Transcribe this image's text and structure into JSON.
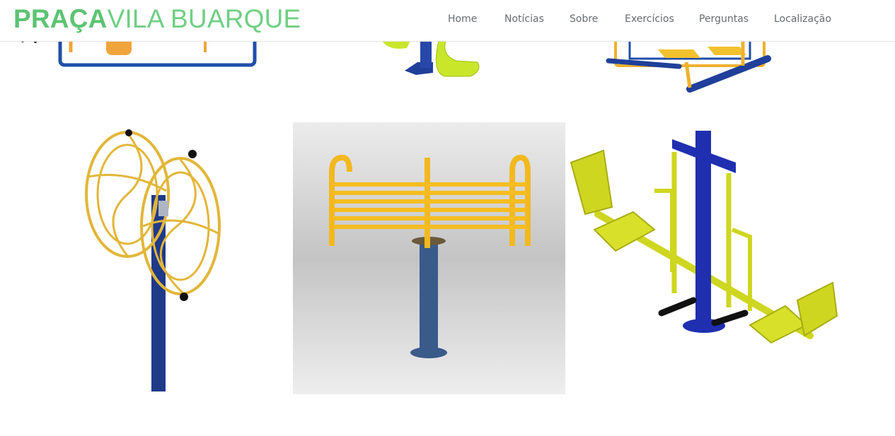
{
  "site": {
    "logo_bold": "PRAÇA",
    "logo_light": "VILA BUARQUE",
    "accent_color": "#5cc472"
  },
  "nav": {
    "items": [
      {
        "label": "Home"
      },
      {
        "label": "Notícias"
      },
      {
        "label": "Sobre"
      },
      {
        "label": "Exercícios"
      },
      {
        "label": "Perguntas"
      },
      {
        "label": "Localização"
      }
    ]
  },
  "gallery": {
    "images": [
      {
        "subject": "exercise-equipment-orange-seat"
      },
      {
        "subject": "exercise-equipment-green-pedals"
      },
      {
        "subject": "exercise-equipment-multi-station"
      },
      {
        "subject": "exercise-equipment-rotating-wheels"
      },
      {
        "subject": "exercise-equipment-back-stretcher"
      },
      {
        "subject": "exercise-equipment-leg-press-seesaw"
      }
    ],
    "colors": {
      "blue": "#1f3f9a",
      "yellow": "#f2c12e",
      "lime": "#c9e62b",
      "orange": "#f0a43c"
    }
  }
}
